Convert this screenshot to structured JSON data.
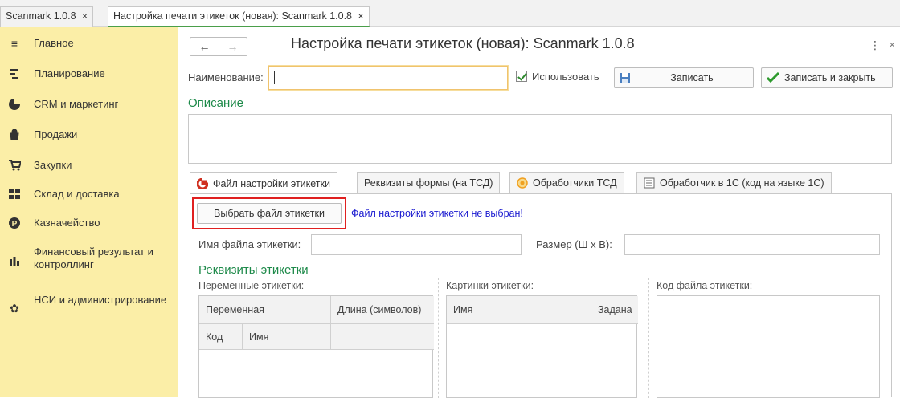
{
  "window_tabs": [
    {
      "label": "Scanmark 1.0.8",
      "close": "×"
    },
    {
      "label": "Настройка печати этикеток (новая): Scanmark 1.0.8",
      "close": "×"
    }
  ],
  "sidebar": {
    "items": [
      {
        "label": "Главное",
        "icon": "menu-icon"
      },
      {
        "label": "Планирование",
        "icon": "planning-icon"
      },
      {
        "label": "CRM и маркетинг",
        "icon": "crm-icon"
      },
      {
        "label": "Продажи",
        "icon": "sales-bag-icon"
      },
      {
        "label": "Закупки",
        "icon": "cart-icon"
      },
      {
        "label": "Склад и доставка",
        "icon": "warehouse-icon"
      },
      {
        "label": "Казначейство",
        "icon": "treasury-icon"
      },
      {
        "label": "Финансовый результат и контроллинг",
        "icon": "bar-chart-icon"
      },
      {
        "label": "НСИ и администрирование",
        "icon": "gear-icon"
      }
    ]
  },
  "header": {
    "title": "Настройка печати этикеток (новая): Scanmark 1.0.8",
    "back": "←",
    "forward": "→",
    "more": "⋮",
    "close": "×"
  },
  "form": {
    "name_label": "Наименование:",
    "name_value": "",
    "use_label": "Использовать",
    "use_checked": true,
    "save_label": "Записать",
    "save_close_label": "Записать и закрыть",
    "description_link": "Описание",
    "description_value": ""
  },
  "tabs": [
    {
      "label": "Файл настройки этикетки",
      "icon": "label-settings-icon",
      "active": true
    },
    {
      "label": "Реквизиты формы (на ТСД)",
      "icon": "",
      "active": false
    },
    {
      "label": "Обработчики ТСД",
      "icon": "handler-icon",
      "active": false
    },
    {
      "label": "Обработчик в 1С  (код на языке 1С)",
      "icon": "code-icon",
      "active": false
    }
  ],
  "panel": {
    "choose_file_label": "Выбрать файл этикетки",
    "file_status": "Файл настройки этикетки не выбран!",
    "filename_label": "Имя файла этикетки:",
    "filename_value": "",
    "size_label": "Размер (Ш х В):",
    "size_value": "",
    "section_title": "Реквизиты этикетки",
    "variables_label": "Переменные этикетки:",
    "images_label": "Картинки этикетки:",
    "code_label": "Код файла этикетки:",
    "variables_grid": {
      "col_variable": "Переменная",
      "col_length": "Длина (символов)",
      "col_code": "Код",
      "col_name": "Имя"
    },
    "images_grid": {
      "col_name": "Имя",
      "col_set": "Задана"
    }
  },
  "colors": {
    "sidebar_bg": "#fbeea7",
    "green_link": "#1e8a4a",
    "status_blue": "#1a1ad0",
    "highlight_red": "#e02020",
    "save_check_green": "#2d9a2d",
    "tab_icon_red": "#d03020",
    "tab_icon_orange": "#f0a020"
  }
}
